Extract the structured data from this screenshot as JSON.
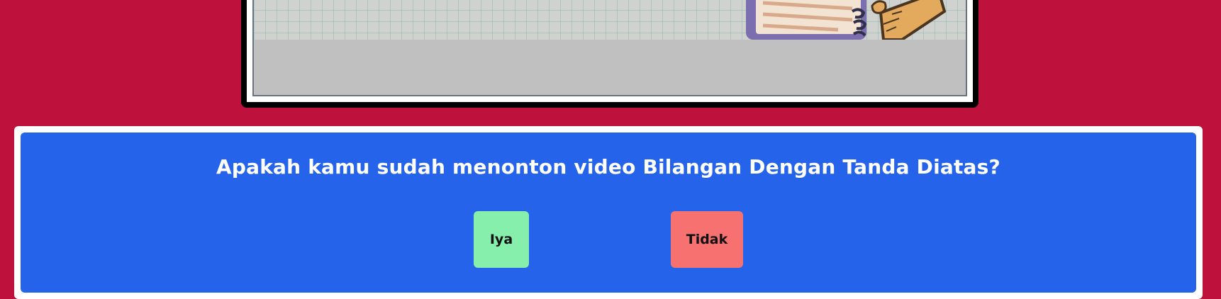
{
  "video": {
    "thumbnail_icons": [
      "notebook-icon",
      "ruler-icon"
    ]
  },
  "question_panel": {
    "question": "Apakah kamu sudah menonton video Bilangan Dengan Tanda Diatas?",
    "yes_label": "Iya",
    "no_label": "Tidak"
  },
  "colors": {
    "background": "#be123c",
    "panel": "#2563eb",
    "yes_button": "#86efac",
    "no_button": "#f87171"
  }
}
